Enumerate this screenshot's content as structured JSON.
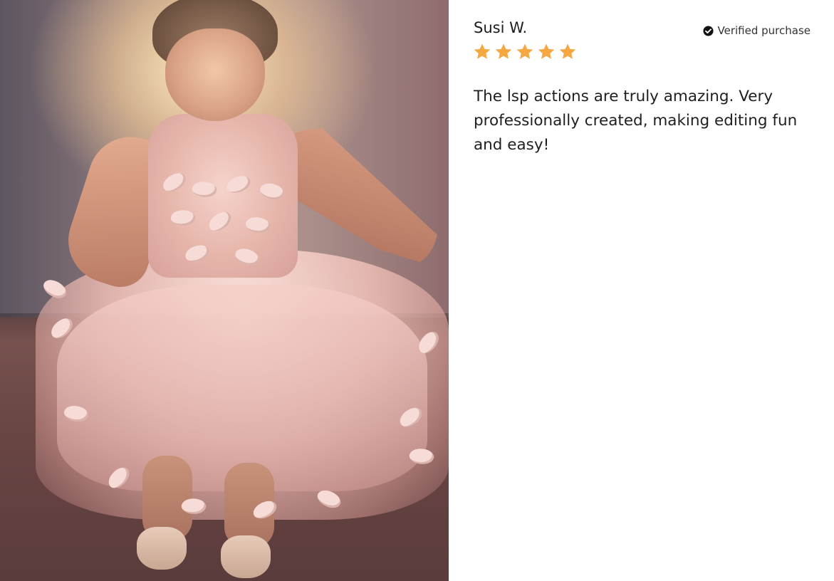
{
  "review": {
    "reviewer_name": "Susi W.",
    "verified_label": "Verified purchase",
    "verified_icon": "check-circle-icon",
    "rating": 5,
    "rating_max": 5,
    "star_icon": "star-icon",
    "star_color": "#f5a742",
    "text": "The lsp actions are truly amazing. Very professionally created, making editing fun and easy!"
  },
  "colors": {
    "text_primary": "#1c1c1c",
    "text_secondary": "#333333",
    "background": "#ffffff"
  }
}
